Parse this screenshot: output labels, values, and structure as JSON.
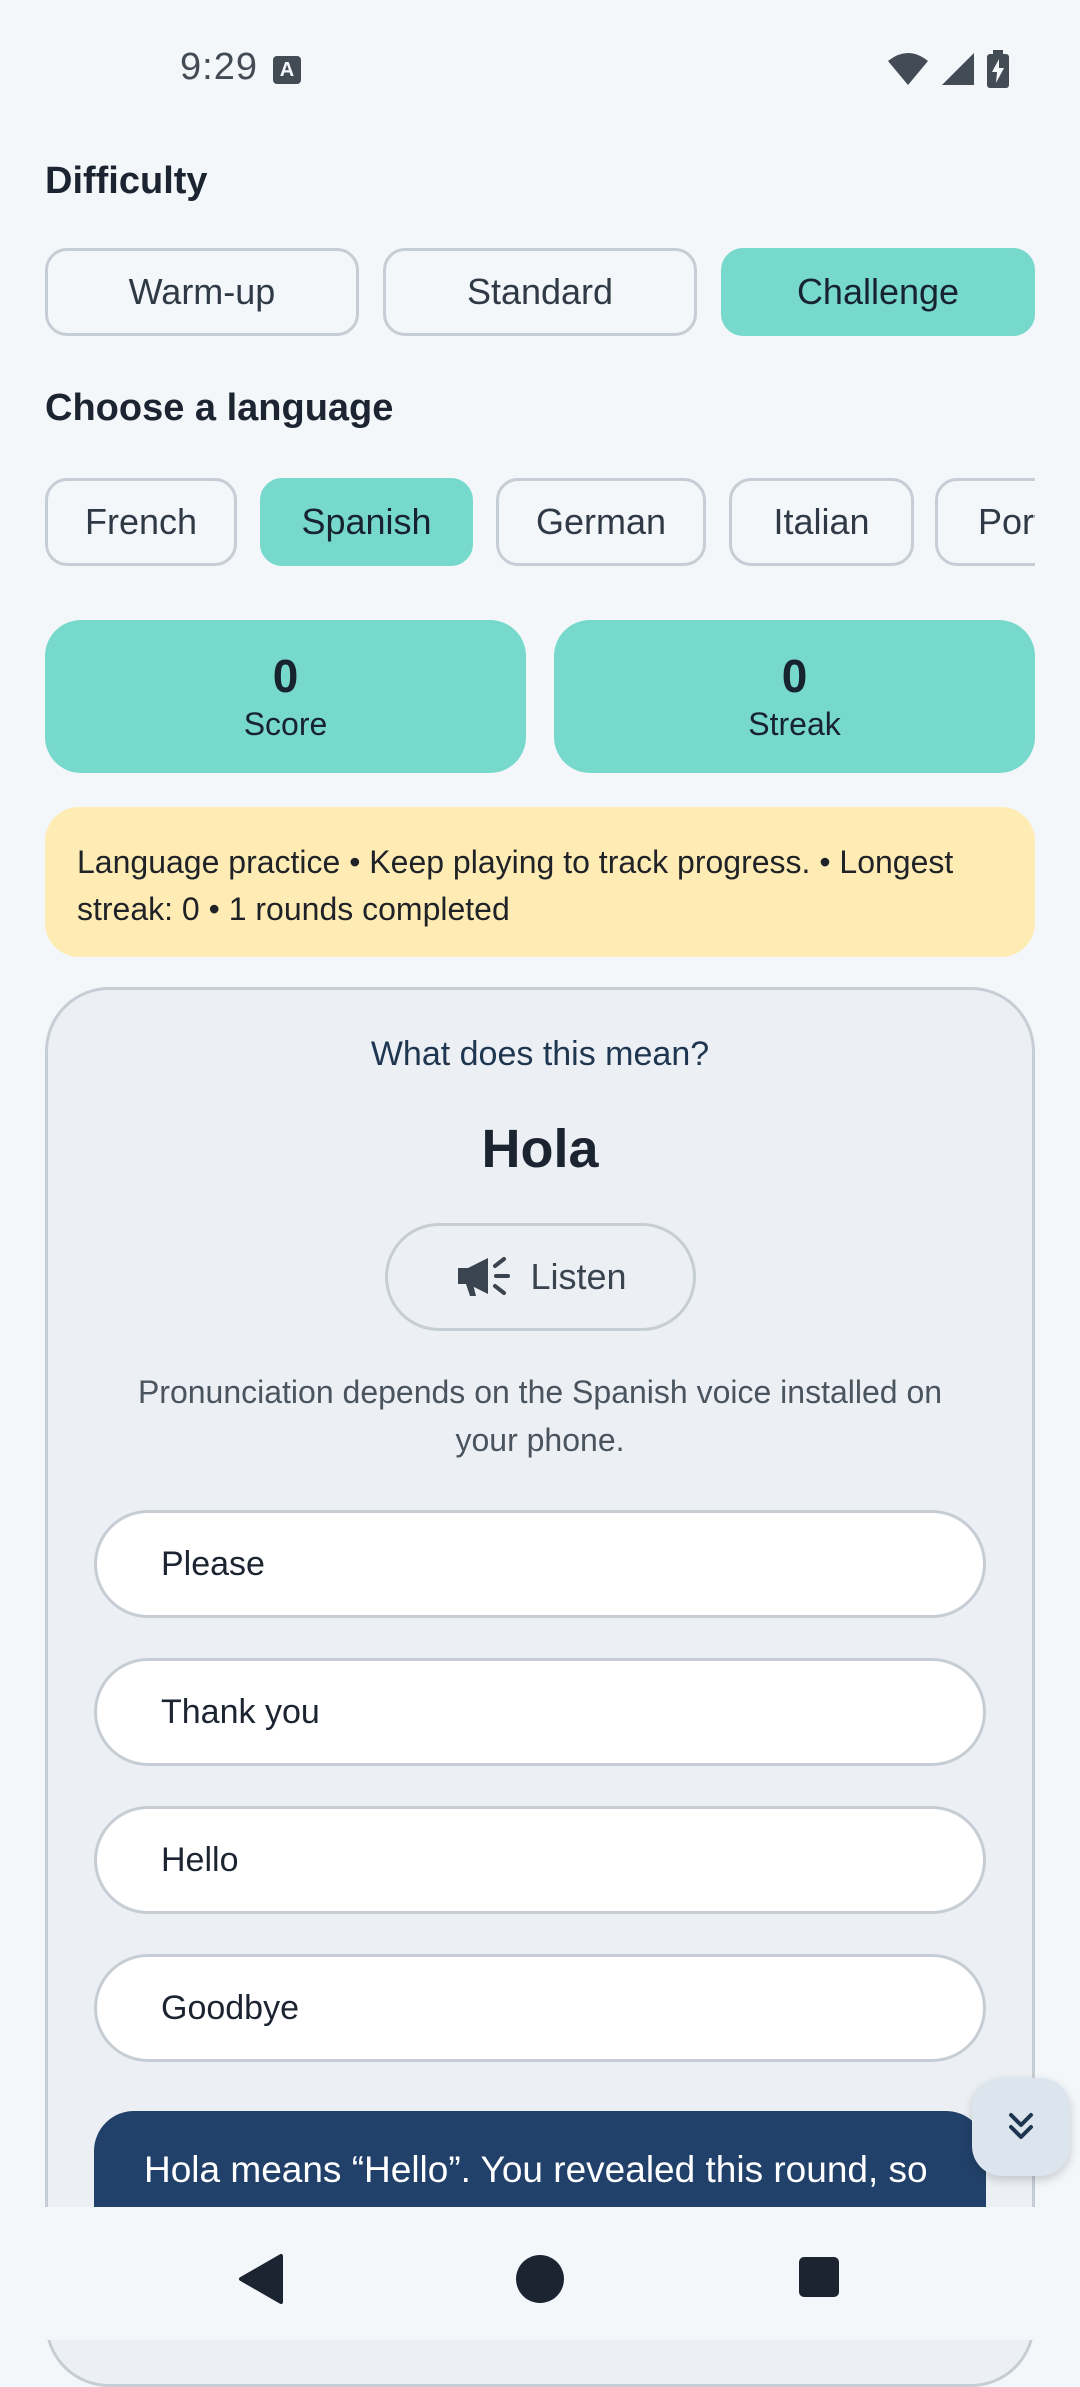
{
  "status_bar": {
    "time": "9:29",
    "badge": "A"
  },
  "difficulty": {
    "title": "Difficulty",
    "options": [
      "Warm-up",
      "Standard",
      "Challenge"
    ],
    "selected": "Challenge"
  },
  "language": {
    "title": "Choose a language",
    "options": [
      "French",
      "Spanish",
      "German",
      "Italian",
      "Portuguese"
    ],
    "selected": "Spanish"
  },
  "stats": {
    "score": {
      "value": "0",
      "label": "Score"
    },
    "streak": {
      "value": "0",
      "label": "Streak"
    }
  },
  "info_banner": "Language practice • Keep playing to track progress. • Longest streak: 0 • 1 rounds completed",
  "quiz": {
    "question": "What does this mean?",
    "word": "Hola",
    "listen_label": "Listen",
    "note": "Pronunciation depends on the Spanish voice installed on your phone.",
    "options": [
      "Please",
      "Thank you",
      "Hello",
      "Goodbye"
    ],
    "reveal_text": "Hola means “Hello”. You revealed this round, so"
  },
  "icons": {
    "listen": "megaphone-icon",
    "fab": "double-chevron-down-icon",
    "nav_back": "back-triangle-icon",
    "nav_home": "home-circle-icon",
    "nav_recents": "recents-square-icon"
  },
  "colors": {
    "accent": "#77D8CC",
    "banner": "#FFEBB4",
    "reveal": "#22416A",
    "background": "#F3F7FA"
  }
}
